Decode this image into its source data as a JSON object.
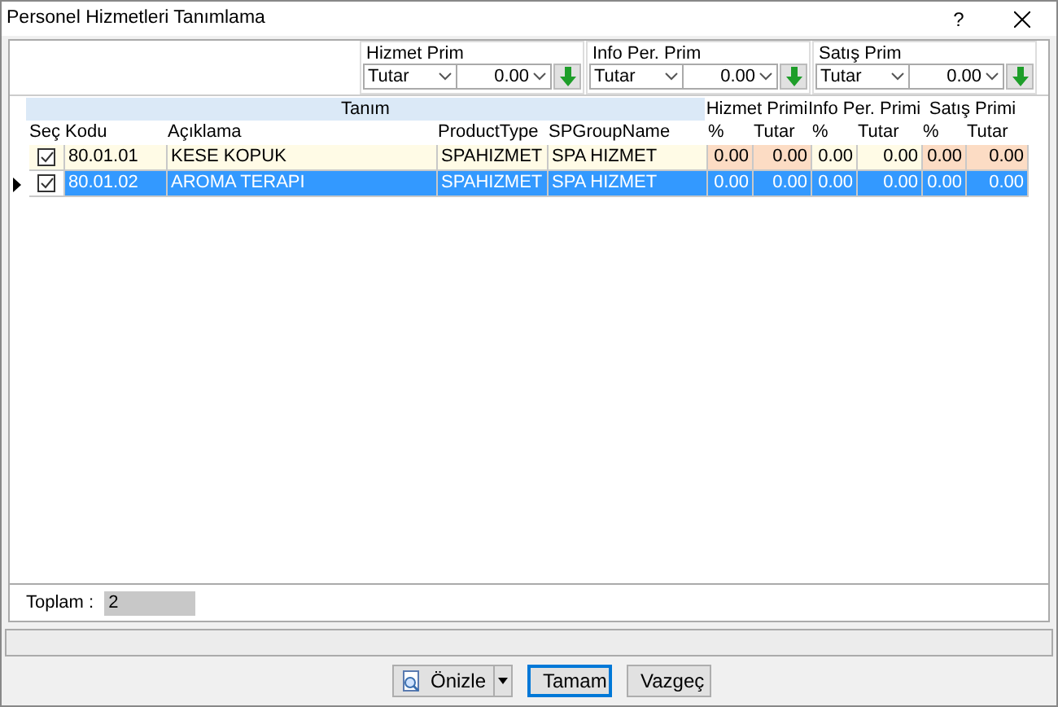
{
  "window": {
    "title": "Personel Hizmetleri Tanımlama",
    "help": "?"
  },
  "filters": [
    {
      "label": "Hizmet Prim",
      "type": "Tutar",
      "amount": "0.00"
    },
    {
      "label": "Info Per. Prim",
      "type": "Tutar",
      "amount": "0.00"
    },
    {
      "label": "Satış Prim",
      "type": "Tutar",
      "amount": "0.00"
    }
  ],
  "grid": {
    "bands": [
      {
        "label": "Tanım"
      },
      {
        "label": "Hizmet Primi"
      },
      {
        "label": "Info Per. Primi"
      },
      {
        "label": "Satış Primi"
      }
    ],
    "columns": [
      "Seç",
      "Kodu",
      "Açıklama",
      "ProductType",
      "SPGroupName",
      "%",
      "Tutar",
      "%",
      "Tutar",
      "%",
      "Tutar"
    ],
    "rows": [
      {
        "selected": false,
        "current": false,
        "cells": [
          {
            "kind": "checkbox",
            "checked": true
          },
          {
            "kind": "text",
            "text": "80.01.01"
          },
          {
            "kind": "text",
            "text": "KESE KOPUK"
          },
          {
            "kind": "text",
            "text": "SPAHIZMET"
          },
          {
            "kind": "text",
            "text": "SPA HIZMET"
          },
          {
            "kind": "number",
            "text": "0.00"
          },
          {
            "kind": "number",
            "text": "0.00"
          },
          {
            "kind": "number",
            "text": "0.00"
          },
          {
            "kind": "number",
            "text": "0.00"
          },
          {
            "kind": "number",
            "text": "0.00"
          },
          {
            "kind": "number",
            "text": "0.00"
          }
        ]
      },
      {
        "selected": true,
        "current": true,
        "cells": [
          {
            "kind": "checkbox",
            "checked": true
          },
          {
            "kind": "text",
            "text": "80.01.02"
          },
          {
            "kind": "text",
            "text": "AROMA TERAPI"
          },
          {
            "kind": "text",
            "text": "SPAHIZMET"
          },
          {
            "kind": "text",
            "text": "SPA HIZMET"
          },
          {
            "kind": "number",
            "text": "0.00"
          },
          {
            "kind": "number",
            "text": "0.00"
          },
          {
            "kind": "number",
            "text": "0.00"
          },
          {
            "kind": "number",
            "text": "0.00"
          },
          {
            "kind": "number",
            "text": "0.00"
          },
          {
            "kind": "number",
            "text": "0.00"
          }
        ]
      }
    ]
  },
  "total": {
    "label": "Toplam :",
    "value": "2"
  },
  "buttons": [
    {
      "kind": "preview",
      "label": "Önizle"
    },
    {
      "kind": "ok",
      "label": "Tamam"
    },
    {
      "kind": "cancel",
      "label": "Vazgeç"
    }
  ]
}
